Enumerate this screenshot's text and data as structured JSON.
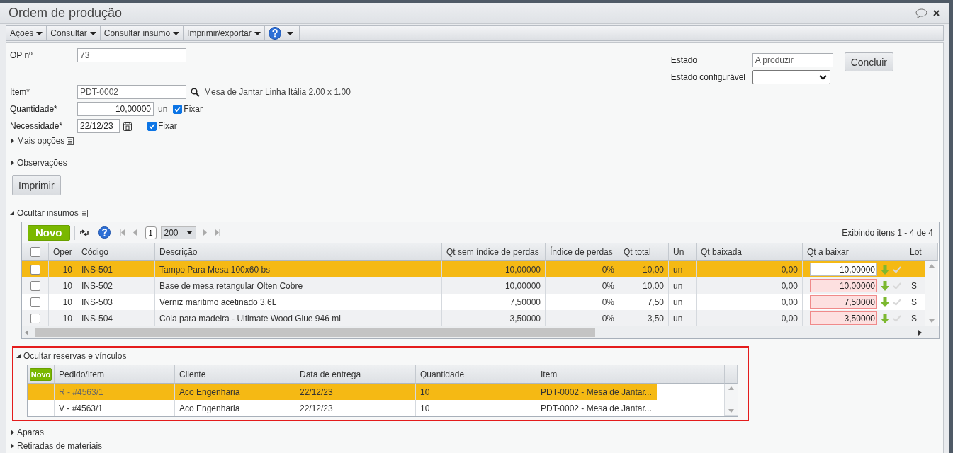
{
  "window": {
    "title": "Ordem de produção"
  },
  "toolbar": [
    {
      "kind": "menu",
      "label": "Ações"
    },
    {
      "kind": "menu",
      "label": "Consultar"
    },
    {
      "kind": "menu",
      "label": "Consultar insumo"
    },
    {
      "kind": "menu",
      "label": "Imprimir/exportar"
    },
    {
      "kind": "help"
    }
  ],
  "form": {
    "op": {
      "label": "OP nº",
      "value": "73"
    },
    "item": {
      "label": "Item*",
      "value": "PDT-0002",
      "description": "Mesa de Jantar Linha Itália 2.00 x 1.00"
    },
    "quantity": {
      "label": "Quantidade*",
      "value": "10,00000",
      "unit": "un",
      "fix": {
        "label": "Fixar",
        "checked": true
      }
    },
    "need": {
      "label": "Necessidade*",
      "value": "22/12/23",
      "fix": {
        "label": "Fixar",
        "checked": true
      }
    },
    "state": {
      "label": "Estado",
      "value": "A produzir"
    },
    "configurable_state": {
      "label": "Estado configurável"
    },
    "conclude_button": "Concluir"
  },
  "sections_top": [
    {
      "label": "Mais opções",
      "expanded": false,
      "list_icon": true
    },
    {
      "label": "Observações",
      "expanded": false,
      "list_icon": false
    }
  ],
  "print_button": "Imprimir",
  "supplies": {
    "label": "Ocultar insumos",
    "expanded": true,
    "list_icon": true,
    "new_button": "Novo",
    "page": "1",
    "page_size": "200",
    "summary": "Exibindo itens 1 - 4 de 4",
    "header_checked": false,
    "columns": [
      "Oper",
      "Código",
      "Descrição",
      "Qt sem índice de perdas",
      "Índice de perdas",
      "Qt total",
      "Un",
      "Qt baixada",
      "Qt a baixar",
      "Lot"
    ],
    "rows": [
      {
        "selected": true,
        "checked": false,
        "oper": "10",
        "code": "INS-501",
        "description": "Tampo Para Mesa 100x60 bs",
        "qty_no_loss": "10,00000",
        "loss_index": "0%",
        "qty_total": "10,00",
        "unit": "un",
        "qty_posted": "0,00",
        "qty_to_post": "10,00000",
        "invalid": false
      },
      {
        "selected": false,
        "checked": false,
        "oper": "10",
        "code": "INS-502",
        "description": "Base de mesa retangular Olten Cobre",
        "qty_no_loss": "10,00000",
        "loss_index": "0%",
        "qty_total": "10,00",
        "unit": "un",
        "qty_posted": "0,00",
        "qty_to_post": "10,00000",
        "invalid": true,
        "lot": "S"
      },
      {
        "selected": false,
        "checked": false,
        "oper": "10",
        "code": "INS-503",
        "description": "Verniz marítimo acetinado 3,6L",
        "qty_no_loss": "7,50000",
        "loss_index": "0%",
        "qty_total": "7,50",
        "unit": "un",
        "qty_posted": "0,00",
        "qty_to_post": "7,50000",
        "invalid": true,
        "lot": "S"
      },
      {
        "selected": false,
        "checked": false,
        "oper": "10",
        "code": "INS-504",
        "description": "Cola para madeira - Ultimate Wood Glue 946 ml",
        "qty_no_loss": "3,50000",
        "loss_index": "0%",
        "qty_total": "3,50",
        "unit": "un",
        "qty_posted": "0,00",
        "qty_to_post": "3,50000",
        "invalid": true,
        "lot": "S"
      }
    ]
  },
  "reservations": {
    "label": "Ocultar reservas e vínculos",
    "expanded": true,
    "new_button": "Novo",
    "columns": [
      "Pedido/Item",
      "Cliente",
      "Data de entrega",
      "Quantidade",
      "Item"
    ],
    "rows": [
      {
        "selected": true,
        "link": true,
        "order": "R - #4563/1",
        "client": "Aco Engenharia",
        "date": "22/12/23",
        "qty": "10",
        "item": "PDT-0002 - Mesa de Jantar..."
      },
      {
        "selected": false,
        "link": false,
        "order": "V - #4563/1",
        "client": "Aco Engenharia",
        "date": "22/12/23",
        "qty": "10",
        "item": "PDT-0002 - Mesa de Jantar..."
      }
    ]
  },
  "sections_bottom": [
    {
      "label": "Aparas",
      "expanded": false
    },
    {
      "label": "Retiradas de materiais",
      "expanded": false
    }
  ]
}
